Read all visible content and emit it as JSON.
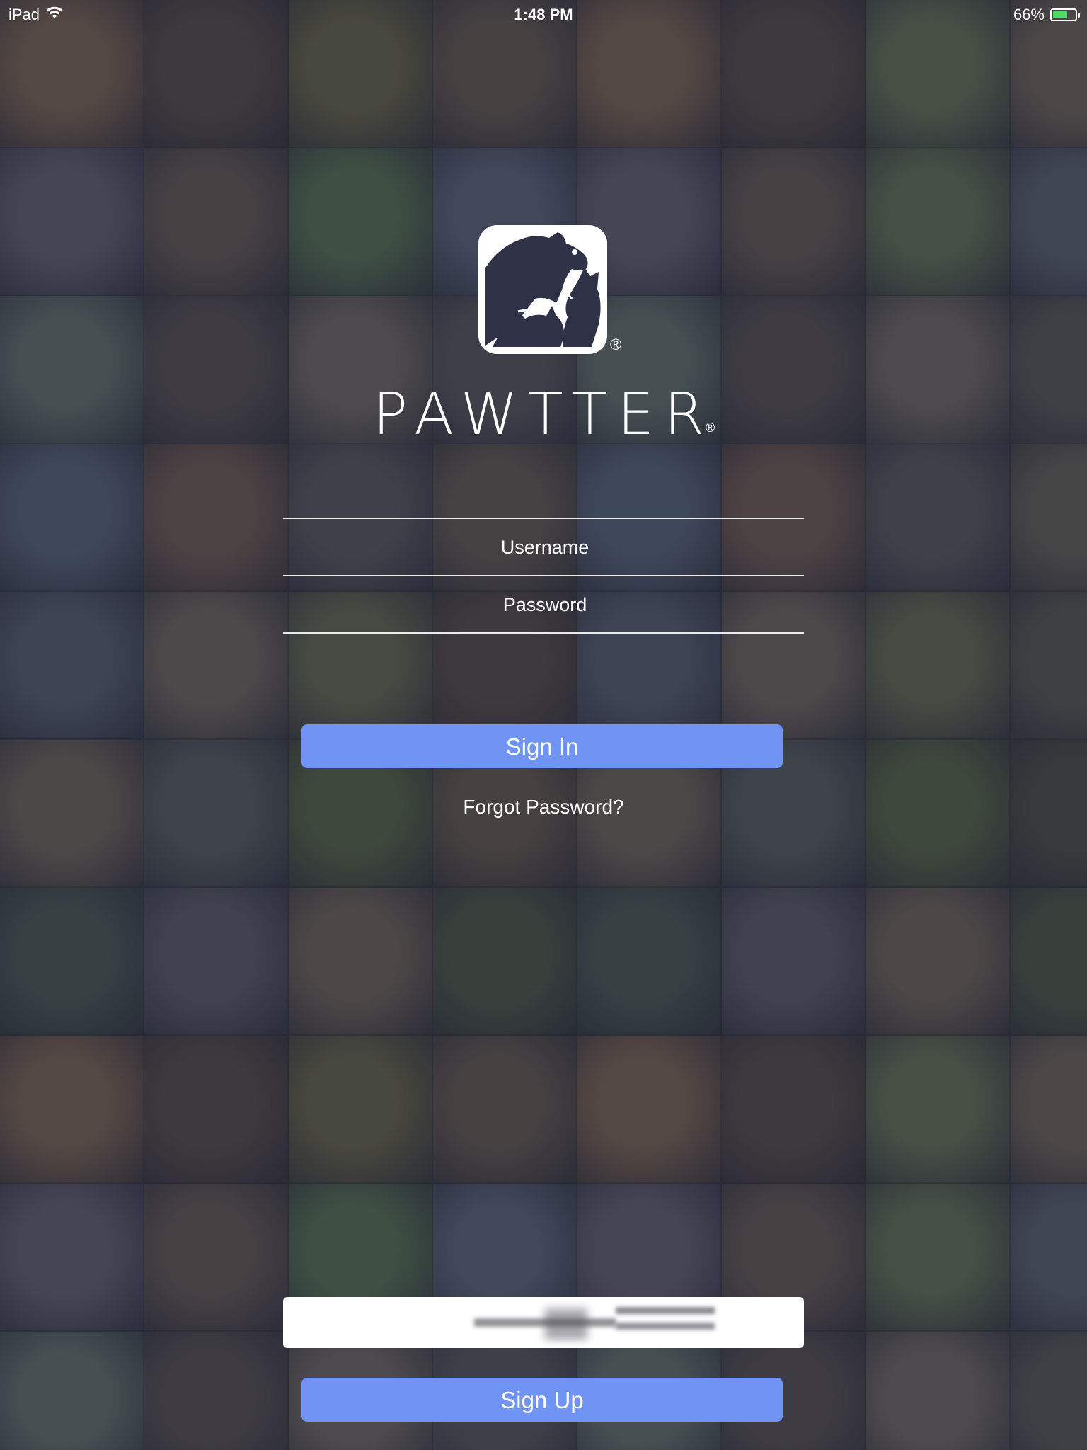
{
  "status_bar": {
    "device": "iPad",
    "time": "1:48 PM",
    "battery_text": "66%",
    "battery_level": 0.66,
    "battery_color": "#4cd964"
  },
  "brand": {
    "name": "PAWTTER",
    "registered_mark": "®",
    "logo_icon": "pets-silhouette-icon"
  },
  "form": {
    "username_placeholder": "Username",
    "password_placeholder": "Password",
    "sign_in_label": "Sign In",
    "forgot_password_label": "Forgot Password?",
    "sign_up_label": "Sign Up"
  },
  "colors": {
    "button": "#6f94f3",
    "overlay": "#282c3e",
    "text": "#ffffff"
  },
  "background": {
    "tiles": [
      "#8a6a4a",
      "#5a4a3a",
      "#6e6a3e",
      "#6a5a46",
      "#8a6a4a",
      "#5a4a3a",
      "#6e7a4e",
      "#7a6a52",
      "#6a6470",
      "#6a5a4a",
      "#5a7a4a",
      "#5e6a7a",
      "#6a6470",
      "#6a5a4a",
      "#6a7a4e",
      "#5e6470",
      "#6a7a6a",
      "#5a5048",
      "#7a7060",
      "#5a5a58",
      "#6a7a6a",
      "#5a5048",
      "#7a7060",
      "#5a5a50",
      "#5a6a7a",
      "#7a5e4a",
      "#5e5a5a",
      "#6a5e4a",
      "#5a6a7a",
      "#7a5e4a",
      "#5e5a5a",
      "#6a6450",
      "#5a6270",
      "#7a6e5a",
      "#6a7048",
      "#5a4a3a",
      "#5a6270",
      "#7a6e5a",
      "#6a7048",
      "#5a5a4a",
      "#7a6a54",
      "#5a625a",
      "#5a6a3a",
      "#6a5a42",
      "#7a6a54",
      "#5a625a",
      "#5a6a3a",
      "#4a4a3a",
      "#4a5a4a",
      "#5e5e66",
      "#7a6a52",
      "#4e5a3a",
      "#4a5a4a",
      "#5e5e66",
      "#7a6a52",
      "#4e5a3a",
      "#8a6a4a",
      "#5a4a3a",
      "#6e6a3e",
      "#6a5a46",
      "#8a6a4a",
      "#5a4a3a",
      "#6e7a4e",
      "#7a6a52",
      "#6a6470",
      "#6a5a4a",
      "#5a7a4a",
      "#5e6a7a",
      "#6a6470",
      "#6a5a4a",
      "#6a7a4e",
      "#5e6470",
      "#6a7a6a",
      "#5a5048",
      "#7a7060",
      "#5a5a58",
      "#6a7a6a",
      "#5a5048",
      "#7a7060",
      "#5a5a50"
    ]
  }
}
